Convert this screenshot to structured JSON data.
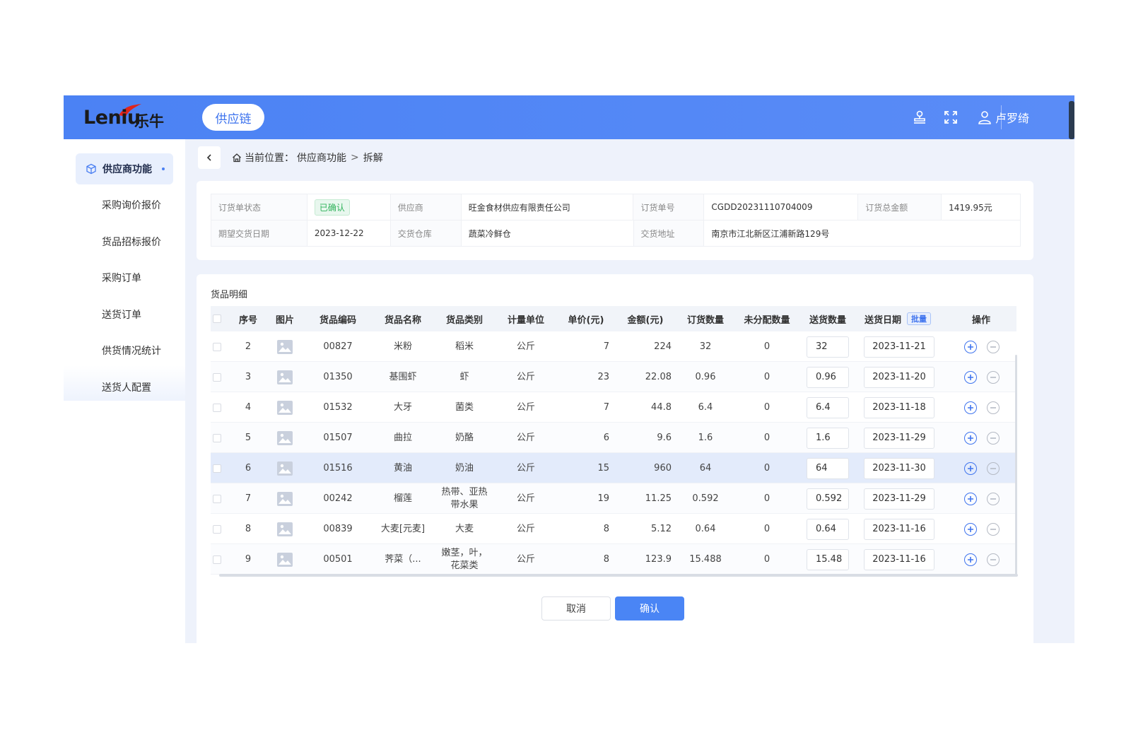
{
  "brand": {
    "logo_text": "Leniu",
    "logo_cn": "乐牛"
  },
  "header": {
    "module": "供应链",
    "user_name": "卢罗绮"
  },
  "icons": {
    "stamp": "stamp-icon",
    "fullscreen": "fullscreen-icon",
    "user": "user-icon",
    "home": "home-icon",
    "back": "chevron-left-icon",
    "cube": "cube-icon"
  },
  "sidebar": {
    "items": [
      {
        "label": "供应商功能",
        "active": true
      },
      {
        "label": "采购询价报价"
      },
      {
        "label": "货品招标报价"
      },
      {
        "label": "采购订单"
      },
      {
        "label": "送货订单"
      },
      {
        "label": "供货情况统计"
      },
      {
        "label": "送货人配置"
      }
    ]
  },
  "breadcrumb": {
    "prefix": "当前位置：",
    "parent": "供应商功能",
    "sep": ">",
    "current": "拆解"
  },
  "info": {
    "row1": [
      {
        "label": "订货单状态",
        "value": "已确认"
      },
      {
        "label": "供应商",
        "value": "旺金食材供应有限责任公司"
      },
      {
        "label": "订货单号",
        "value": "CGDD20231110704009"
      },
      {
        "label": "订货总金额",
        "value": "1419.95元"
      }
    ],
    "row2": [
      {
        "label": "期望交货日期",
        "value": "2023-12-22"
      },
      {
        "label": "交货仓库",
        "value": "蔬菜冷鲜仓"
      },
      {
        "label": "交货地址",
        "value": "南京市江北新区江浦新路129号"
      }
    ]
  },
  "detail": {
    "title": "货品明细",
    "columns": [
      "序号",
      "图片",
      "货品编码",
      "货品名称",
      "货品类别",
      "计量单位",
      "单价(元)",
      "金额(元)",
      "订货数量",
      "未分配数量",
      "送货数量",
      "送货日期",
      "操作"
    ],
    "batch_label": "批量",
    "rows": [
      {
        "no": "2",
        "code": "00827",
        "name": "米粉",
        "category": "稻米",
        "unit": "公斤",
        "price": "7",
        "amount": "224",
        "qty": "32",
        "unassigned": "0",
        "deliver_qty": "32",
        "date": "2023-11-21"
      },
      {
        "no": "3",
        "code": "01350",
        "name": "基围虾",
        "category": "虾",
        "unit": "公斤",
        "price": "23",
        "amount": "22.08",
        "qty": "0.96",
        "unassigned": "0",
        "deliver_qty": "0.96",
        "date": "2023-11-20"
      },
      {
        "no": "4",
        "code": "01532",
        "name": "大牙",
        "category": "菌类",
        "unit": "公斤",
        "price": "7",
        "amount": "44.8",
        "qty": "6.4",
        "unassigned": "0",
        "deliver_qty": "6.4",
        "date": "2023-11-18"
      },
      {
        "no": "5",
        "code": "01507",
        "name": "曲拉",
        "category": "奶酪",
        "unit": "公斤",
        "price": "6",
        "amount": "9.6",
        "qty": "1.6",
        "unassigned": "0",
        "deliver_qty": "1.6",
        "date": "2023-11-29"
      },
      {
        "no": "6",
        "code": "01516",
        "name": "黄油",
        "category": "奶油",
        "unit": "公斤",
        "price": "15",
        "amount": "960",
        "qty": "64",
        "unassigned": "0",
        "deliver_qty": "64",
        "date": "2023-11-30",
        "highlight": true
      },
      {
        "no": "7",
        "code": "00242",
        "name": "榴莲",
        "category": "热带、亚热带水果",
        "unit": "公斤",
        "price": "19",
        "amount": "11.25",
        "qty": "0.592",
        "unassigned": "0",
        "deliver_qty": "0.592",
        "date": "2023-11-29"
      },
      {
        "no": "8",
        "code": "00839",
        "name": "大麦[元麦]",
        "category": "大麦",
        "unit": "公斤",
        "price": "8",
        "amount": "5.12",
        "qty": "0.64",
        "unassigned": "0",
        "deliver_qty": "0.64",
        "date": "2023-11-16"
      },
      {
        "no": "9",
        "code": "00501",
        "name": "荠菜（...",
        "category": "嫩茎，叶，花菜类",
        "unit": "公斤",
        "price": "8",
        "amount": "123.9",
        "qty": "15.488",
        "unassigned": "0",
        "deliver_qty": "15.48",
        "date": "2023-11-16"
      }
    ]
  },
  "actions": {
    "cancel": "取消",
    "confirm": "确认"
  },
  "colors": {
    "header": "#4b82f4",
    "primary": "#3f74ee",
    "success": "#2fb35a",
    "highlight_row": "#e3ebfb"
  }
}
